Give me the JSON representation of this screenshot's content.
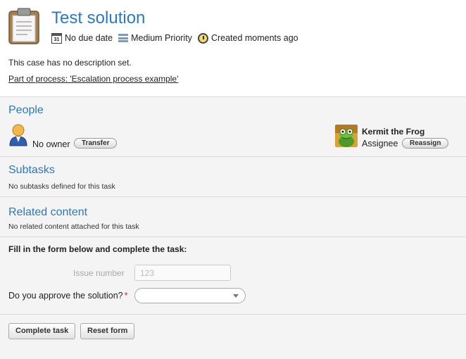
{
  "header": {
    "title": "Test solution",
    "calendar_day": "31",
    "due": "No due date",
    "priority": "Medium Priority",
    "created": "Created moments ago"
  },
  "description": {
    "text": "This case has no description set.",
    "process_link": "Part of process: 'Escalation process example'"
  },
  "people": {
    "title": "People",
    "owner_text": "No owner",
    "transfer_label": "Transfer",
    "assignee_name": "Kermit the Frog",
    "assignee_role": "Assignee",
    "reassign_label": "Reassign"
  },
  "subtasks": {
    "title": "Subtasks",
    "empty_text": "No subtasks defined for this task"
  },
  "related": {
    "title": "Related content",
    "empty_text": "No related content attached for this task"
  },
  "form": {
    "title": "Fill in the form below and complete the task:",
    "issue_label": "Issue number",
    "issue_value": "123",
    "approve_label": "Do you approve the solution?",
    "required_mark": "*",
    "approve_value": ""
  },
  "actions": {
    "complete_label": "Complete task",
    "reset_label": "Reset form"
  },
  "colors": {
    "accent": "#2b79c2",
    "required": "#dd2222"
  }
}
